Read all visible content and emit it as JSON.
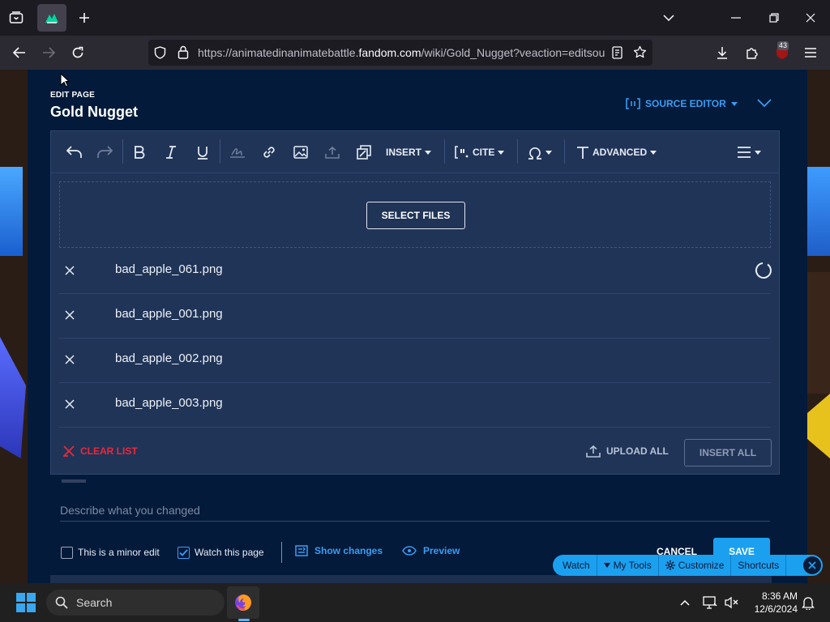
{
  "browser": {
    "url_pre": "https://animatedinanimatebattle.",
    "url_domain": "fandom.com",
    "url_post": "/wiki/Gold_Nugget?veaction=editsou",
    "ext_badge": "43"
  },
  "editor": {
    "edit_label": "EDIT PAGE",
    "page_title": "Gold Nugget",
    "source_editor_label": "SOURCE EDITOR",
    "toolbar": {
      "insert_label": "INSERT",
      "cite_label": "CITE",
      "advanced_label": "ADVANCED"
    },
    "upload": {
      "select_files_label": "SELECT FILES",
      "files": [
        {
          "name": "bad_apple_061.png"
        },
        {
          "name": "bad_apple_001.png"
        },
        {
          "name": "bad_apple_002.png"
        },
        {
          "name": "bad_apple_003.png"
        }
      ],
      "clear_list_label": "CLEAR LIST",
      "upload_all_label": "UPLOAD ALL",
      "insert_all_label": "INSERT ALL"
    },
    "summary_placeholder": "Describe what you changed",
    "minor_edit_label": "This is a minor edit",
    "watch_page_label": "Watch this page",
    "show_changes_label": "Show changes",
    "preview_label": "Preview",
    "cancel_label": "CANCEL",
    "save_label": "SAVE"
  },
  "fandom_bar": {
    "watch": "Watch",
    "my_tools": "My Tools",
    "customize": "Customize",
    "shortcuts": "Shortcuts"
  },
  "taskbar": {
    "search_label": "Search",
    "time": "8:36 AM",
    "date": "12/6/2024"
  },
  "colors": {
    "accent": "#1ba0f0",
    "link": "#3b9cf3",
    "danger": "#e8293d",
    "panel": "#031a3a",
    "dialog": "#203457"
  }
}
